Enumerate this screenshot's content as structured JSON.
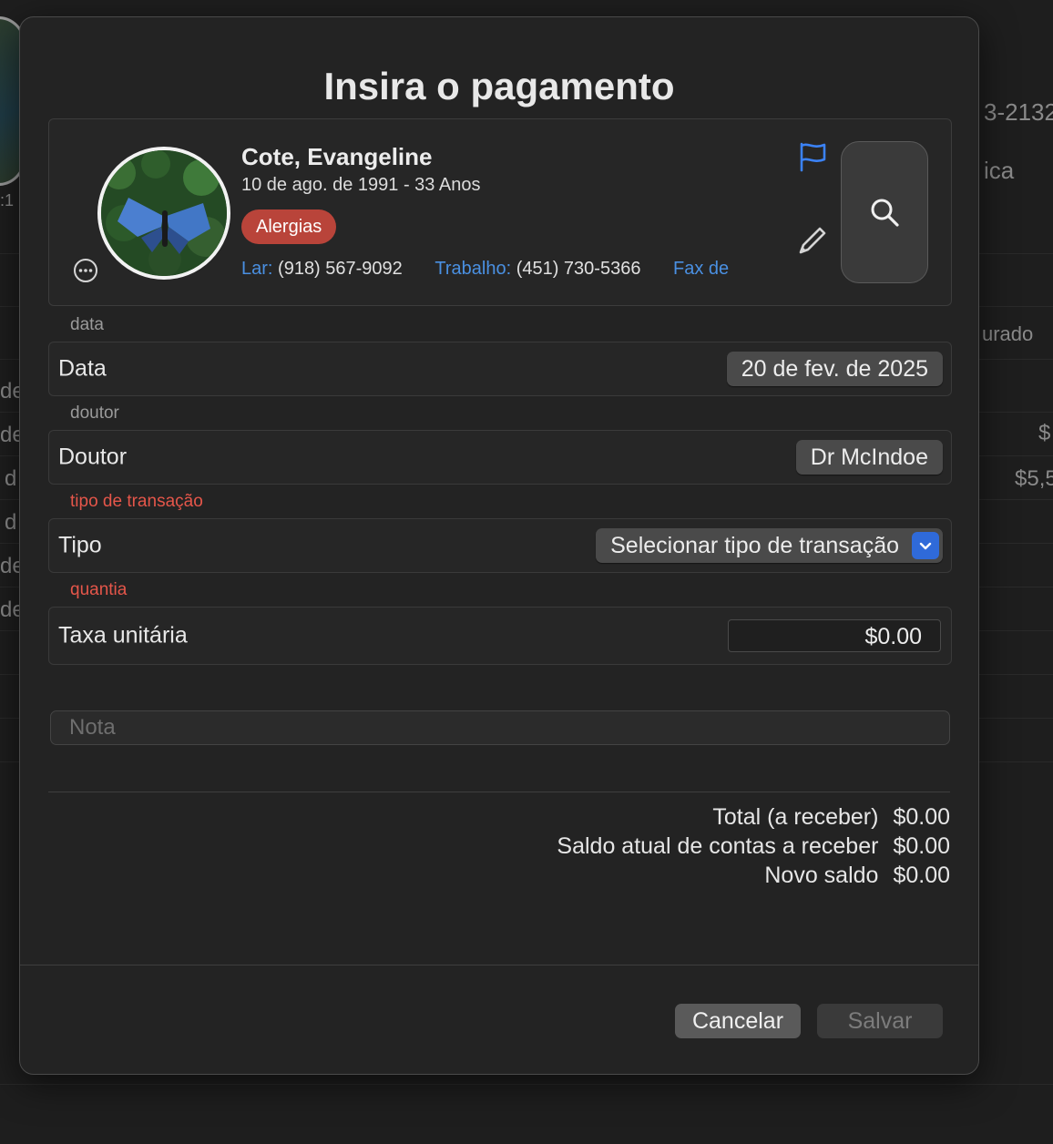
{
  "background": {
    "texts": [
      "3-2132",
      "ica",
      "urado",
      "$",
      "$5,5",
      ":1",
      "de",
      "de",
      "d",
      "d",
      "de",
      "de"
    ]
  },
  "sheet": {
    "title": "Insira o pagamento"
  },
  "patient": {
    "name": "Cote, Evangeline",
    "dob": "10 de ago. de 1991 - 33 Anos",
    "allergy_badge": "Alergias",
    "phones": [
      {
        "label": "Lar:",
        "value": "(918) 567-9092"
      },
      {
        "label": "Trabalho:",
        "value": "(451) 730-5366"
      },
      {
        "label": "Fax de",
        "value": ""
      }
    ],
    "icons": {
      "flag": "flag-icon",
      "pencil": "pencil-icon",
      "search": "search-icon",
      "more": "more-icon"
    }
  },
  "form": {
    "date_section": "data",
    "date_label": "Data",
    "date_value": "20 de fev. de 2025",
    "doctor_section": "doutor",
    "doctor_label": "Doutor",
    "doctor_value": "Dr McIndoe",
    "type_section": "tipo de transação",
    "type_label": "Tipo",
    "type_value": "Selecionar tipo de transação",
    "amount_section": "quantia",
    "amount_label": "Taxa unitária",
    "amount_value": "$0.00",
    "note_placeholder": "Nota",
    "note_value": ""
  },
  "totals": [
    {
      "label": "Total (a receber)",
      "value": "$0.00"
    },
    {
      "label": "Saldo atual de contas a receber",
      "value": "$0.00"
    },
    {
      "label": "Novo saldo",
      "value": "$0.00"
    }
  ],
  "buttons": {
    "cancel": "Cancelar",
    "save": "Salvar"
  },
  "colors": {
    "accent_blue": "#4a90e2",
    "error_red": "#e5564a",
    "allergy_red": "#b9443a",
    "select_blue": "#2f6ad9"
  }
}
